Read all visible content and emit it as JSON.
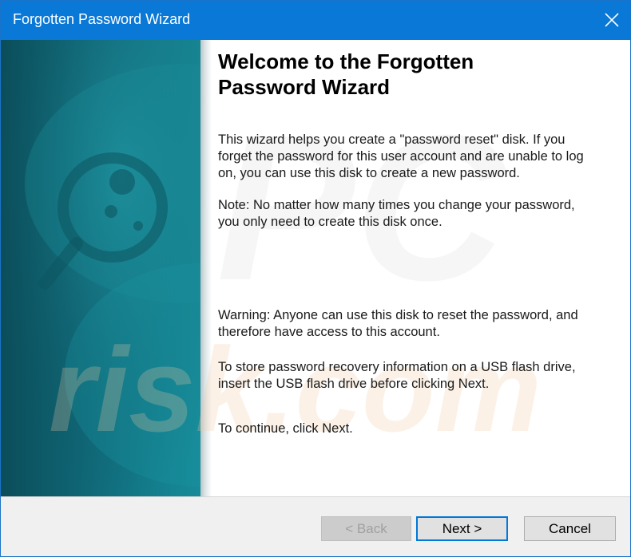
{
  "window": {
    "title": "Forgotten Password Wizard",
    "accent": "#0a78d7"
  },
  "content": {
    "heading": "Welcome to the Forgotten Password Wizard",
    "intro": "This wizard helps you create a \"password reset\" disk. If you forget the password for this user account and are unable to log on, you can use this disk to create a new password.",
    "note": "Note: No matter how many times you change your password, you only need to create this disk once.",
    "warning": "Warning: Anyone can use this disk to reset the password, and therefore have access to this account.",
    "usb": "To store password recovery information on a USB flash drive, insert the USB flash drive before clicking Next.",
    "continue": "To continue, click Next."
  },
  "buttons": {
    "back": "< Back",
    "next": "Next >",
    "cancel": "Cancel"
  },
  "icons": {
    "close": "close-icon"
  }
}
